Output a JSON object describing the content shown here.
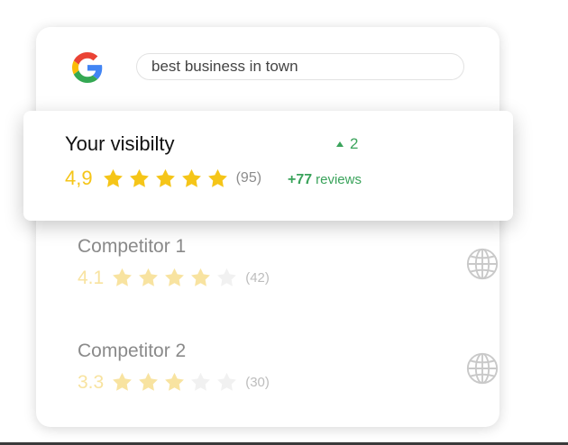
{
  "search": {
    "query": "best business in town"
  },
  "your": {
    "title": "Your visibilty",
    "change": "2",
    "score": "4,9",
    "stars": [
      1,
      1,
      1,
      1,
      1
    ],
    "count": "(95)",
    "reviews_delta": "+77",
    "reviews_label": "reviews"
  },
  "competitors": [
    {
      "name": "Competitor 1",
      "score": "4.1",
      "stars": [
        1,
        1,
        1,
        1,
        0
      ],
      "count": "(42)"
    },
    {
      "name": "Competitor 2",
      "score": "3.3",
      "stars": [
        1,
        1,
        1,
        0,
        0
      ],
      "count": "(30)"
    }
  ],
  "colors": {
    "star_active": "#f5c518",
    "star_faded": "#f8e3a0",
    "star_empty": "#f1f1f1",
    "positive": "#3aa35b",
    "globe": "#c9c9c9"
  },
  "icons": {
    "logo": "google-g-logo",
    "up": "triangle-up-icon",
    "globe": "globe-icon",
    "star": "star-icon"
  }
}
